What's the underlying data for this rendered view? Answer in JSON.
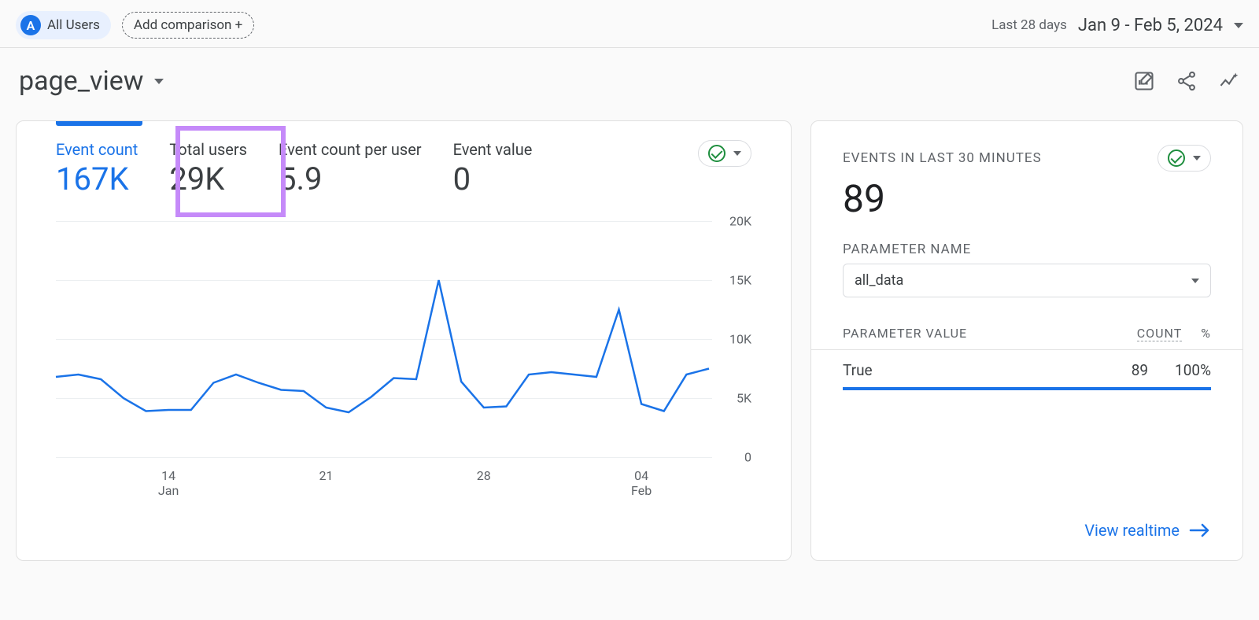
{
  "topbar": {
    "all_users_avatar": "A",
    "all_users_label": "All Users",
    "add_comparison_label": "Add comparison +",
    "date_hint": "Last 28 days",
    "date_range": "Jan 9 - Feb 5, 2024"
  },
  "title": {
    "event_name": "page_view"
  },
  "main_card": {
    "metrics": [
      {
        "label": "Event count",
        "value": "167K",
        "active": true
      },
      {
        "label": "Total users",
        "value": "29K",
        "active": false
      },
      {
        "label": "Event count per user",
        "value": "5.9",
        "active": false
      },
      {
        "label": "Event value",
        "value": "0",
        "active": false
      }
    ]
  },
  "chart_data": {
    "type": "line",
    "ylim": [
      0,
      20000
    ],
    "yticks": [
      0,
      5000,
      10000,
      15000,
      20000
    ],
    "ylabels": [
      "0",
      "5K",
      "10K",
      "15K",
      "20K"
    ],
    "x": [
      "Jan 9",
      "Jan 10",
      "Jan 11",
      "Jan 12",
      "Jan 13",
      "Jan 14",
      "Jan 15",
      "Jan 16",
      "Jan 17",
      "Jan 18",
      "Jan 19",
      "Jan 20",
      "Jan 21",
      "Jan 22",
      "Jan 23",
      "Jan 24",
      "Jan 25",
      "Jan 26",
      "Jan 27",
      "Jan 28",
      "Jan 29",
      "Jan 30",
      "Jan 31",
      "Feb 01",
      "Feb 02",
      "Feb 03",
      "Feb 04",
      "Feb 05"
    ],
    "xticks_visible": [
      {
        "label_top": "14",
        "label_bottom": "Jan"
      },
      {
        "label_top": "21",
        "label_bottom": ""
      },
      {
        "label_top": "28",
        "label_bottom": ""
      },
      {
        "label_top": "04",
        "label_bottom": "Feb"
      }
    ],
    "series": [
      {
        "name": "Event count",
        "values": [
          6800,
          7000,
          6600,
          5000,
          3900,
          4000,
          4000,
          6300,
          7000,
          6300,
          5700,
          5600,
          4200,
          3800,
          5100,
          6700,
          6600,
          15000,
          6400,
          4200,
          4300,
          7000,
          7200,
          7000,
          6800,
          12500,
          4500,
          3900,
          7000,
          7500
        ]
      }
    ]
  },
  "side_card": {
    "title": "EVENTS IN LAST 30 MINUTES",
    "value": "89",
    "param_name_label": "PARAMETER NAME",
    "param_name_value": "all_data",
    "col_value": "PARAMETER VALUE",
    "col_count": "COUNT",
    "col_pct": "%",
    "rows": [
      {
        "value": "True",
        "count": "89",
        "pct": "100%"
      }
    ],
    "view_realtime": "View realtime"
  },
  "icons": {
    "edit": "edit-chart-icon",
    "share": "share-icon",
    "sparkle": "insights-icon"
  }
}
